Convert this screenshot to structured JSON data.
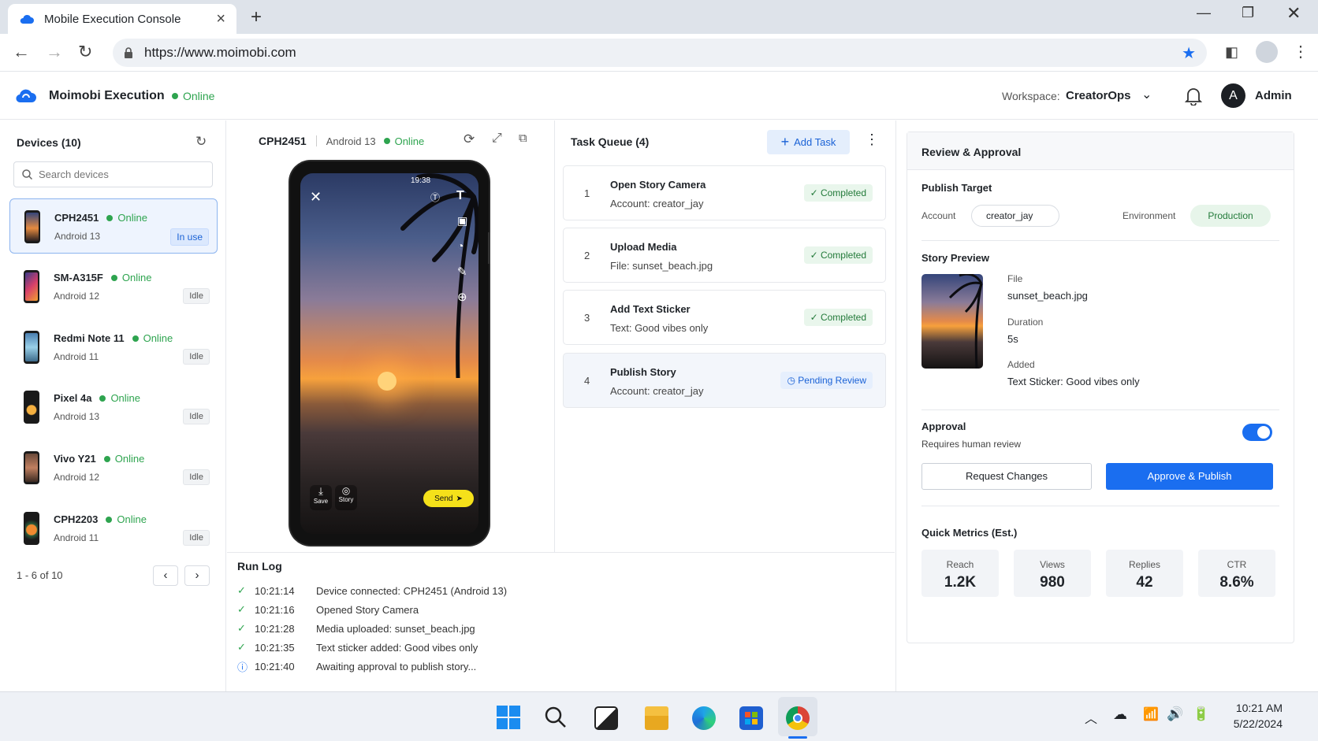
{
  "browser": {
    "tab_title": "Mobile Execution Console",
    "url": "https://www.moimobi.com"
  },
  "app": {
    "name": "Moimobi Execution",
    "status": "Online",
    "workspace_label": "Workspace:",
    "workspace_value": "CreatorOps",
    "user_initial": "A",
    "user_name": "Admin",
    "accent": "#1a6ef0"
  },
  "devices": {
    "title": "Devices (10)",
    "search_placeholder": "Search devices",
    "items": [
      {
        "name": "CPH2451",
        "status": "Online",
        "os": "Android 13",
        "badge": "In use"
      },
      {
        "name": "SM-A315F",
        "status": "Online",
        "os": "Android 12",
        "badge": "Idle"
      },
      {
        "name": "Redmi Note 11",
        "status": "Online",
        "os": "Android 11",
        "badge": "Idle"
      },
      {
        "name": "Pixel 4a",
        "status": "Online",
        "os": "Android 13",
        "badge": "Idle"
      },
      {
        "name": "Vivo Y21",
        "status": "Online",
        "os": "Android 12",
        "badge": "Idle"
      },
      {
        "name": "CPH2203",
        "status": "Online",
        "os": "Android 11",
        "badge": "Idle"
      }
    ],
    "pagination": "1 - 6 of 10"
  },
  "device_view": {
    "name": "CPH2451",
    "os": "Android 13",
    "status": "Online",
    "phone_time": "19:38",
    "save_label": "Save",
    "story_label": "Story",
    "send_label": "Send"
  },
  "task_queue": {
    "title": "Task Queue (4)",
    "add_label": "Add Task",
    "tasks": [
      {
        "num": "1",
        "title": "Open Story Camera",
        "sub": "Account: creator_jay",
        "status": "Completed"
      },
      {
        "num": "2",
        "title": "Upload Media",
        "sub": "File: sunset_beach.jpg",
        "status": "Completed"
      },
      {
        "num": "3",
        "title": "Add Text Sticker",
        "sub": "Text: Good vibes only",
        "status": "Completed"
      },
      {
        "num": "4",
        "title": "Publish Story",
        "sub": "Account: creator_jay",
        "status": "Pending Review"
      }
    ]
  },
  "run_log": {
    "title": "Run Log",
    "entries": [
      {
        "time": "10:21:14",
        "msg": "Device connected: CPH2451 (Android 13)"
      },
      {
        "time": "10:21:16",
        "msg": "Opened Story Camera"
      },
      {
        "time": "10:21:28",
        "msg": "Media uploaded: sunset_beach.jpg"
      },
      {
        "time": "10:21:35",
        "msg": "Text sticker added: Good vibes only"
      },
      {
        "time": "10:21:40",
        "msg": "Awaiting approval to publish story..."
      }
    ]
  },
  "review": {
    "title": "Review & Approval",
    "publish_target": "Publish Target",
    "account_label": "Account",
    "account_value": "creator_jay",
    "env_label": "Environment",
    "env_value": "Production",
    "story_preview": "Story Preview",
    "file_label": "File",
    "file_value": "sunset_beach.jpg",
    "duration_label": "Duration",
    "duration_value": "5s",
    "added_label": "Added",
    "added_value": "Text Sticker: Good vibes only",
    "approval_title": "Approval",
    "approval_sub": "Requires human review",
    "request_changes": "Request Changes",
    "approve_publish": "Approve & Publish",
    "metrics_title": "Quick Metrics (Est.)",
    "metrics": [
      {
        "label": "Reach",
        "value": "1.2K"
      },
      {
        "label": "Views",
        "value": "980"
      },
      {
        "label": "Replies",
        "value": "42"
      },
      {
        "label": "CTR",
        "value": "8.6%"
      }
    ]
  },
  "taskbar": {
    "time": "10:21 AM",
    "date": "5/22/2024"
  }
}
